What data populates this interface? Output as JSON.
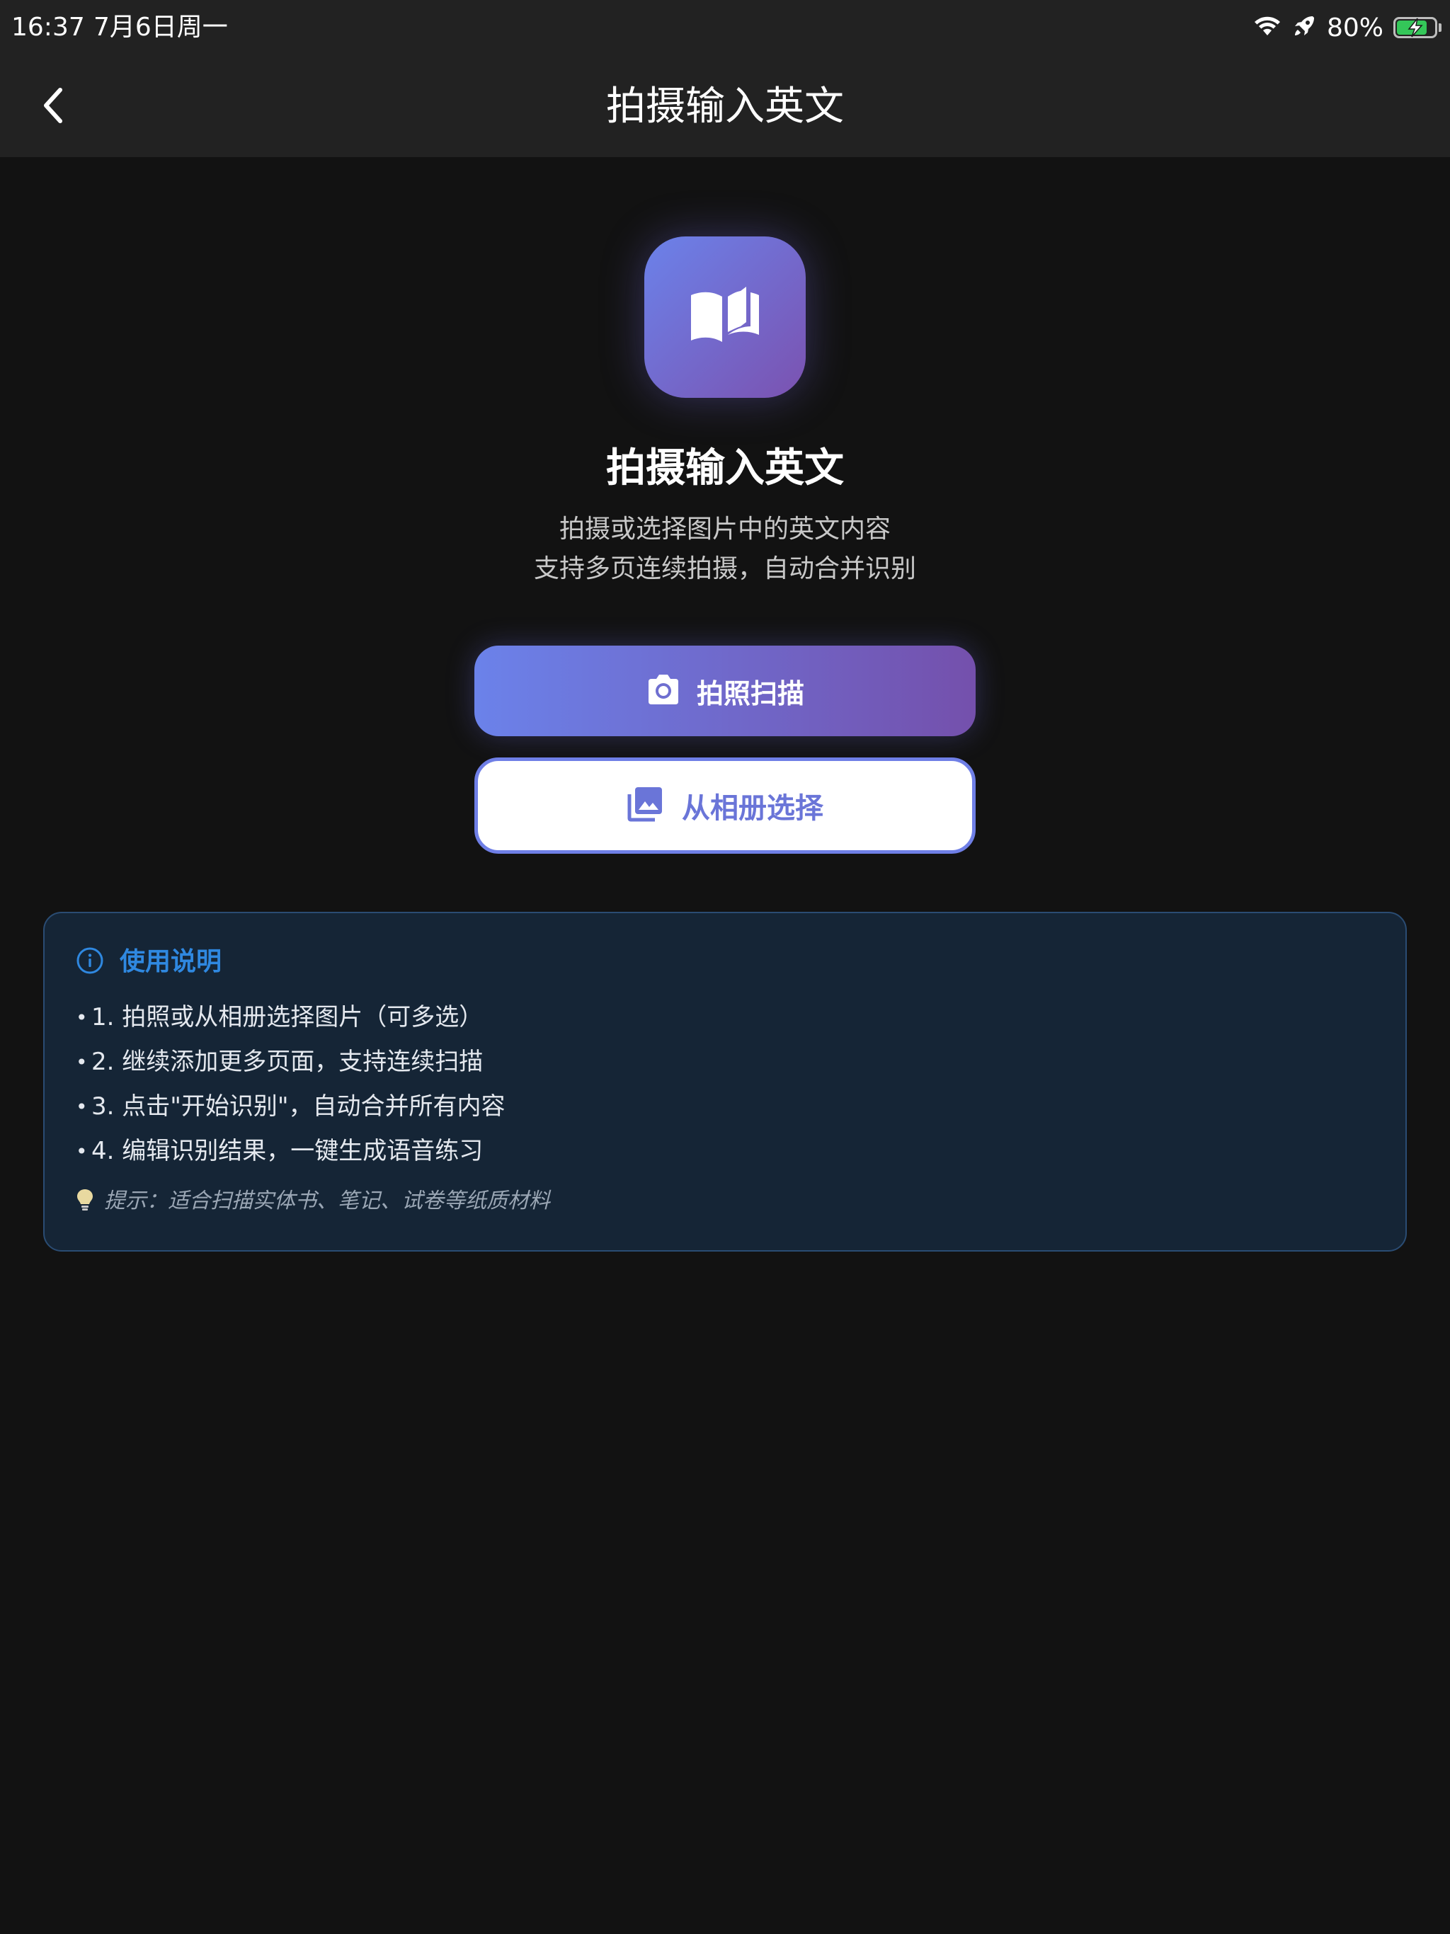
{
  "status_bar": {
    "time": "16:37",
    "date": "7月6日周一",
    "battery_percent": "80%",
    "battery_level": 0.8,
    "icons": [
      "wifi-icon",
      "rocket-icon",
      "battery-charging-icon"
    ]
  },
  "nav": {
    "title": "拍摄输入英文",
    "back_icon": "chevron-left-icon"
  },
  "hero": {
    "icon": "open-book-icon",
    "title": "拍摄输入英文",
    "subtitle_line1": "拍摄或选择图片中的英文内容",
    "subtitle_line2": "支持多页连续拍摄，自动合并识别"
  },
  "actions": {
    "camera_label": "拍照扫描",
    "camera_icon": "camera-icon",
    "album_label": "从相册选择",
    "album_icon": "photo-library-icon"
  },
  "instructions": {
    "title": "使用说明",
    "icon": "info-icon",
    "items": [
      "1. 拍照或从相册选择图片（可多选）",
      "2. 继续添加更多页面，支持连续扫描",
      "3. 点击\"开始识别\"，自动合并所有内容",
      "4. 编辑识别结果，一键生成语音练习"
    ],
    "tip_icon": "lightbulb-icon",
    "tip": "提示：适合扫描实体书、笔记、试卷等纸质材料"
  },
  "colors": {
    "background": "#121212",
    "bar": "#222222",
    "accent_start": "#6b82ea",
    "accent_end": "#7450ac",
    "card_bg": "#152536",
    "card_border": "#2a4c73",
    "info_blue": "#2f88e0"
  }
}
